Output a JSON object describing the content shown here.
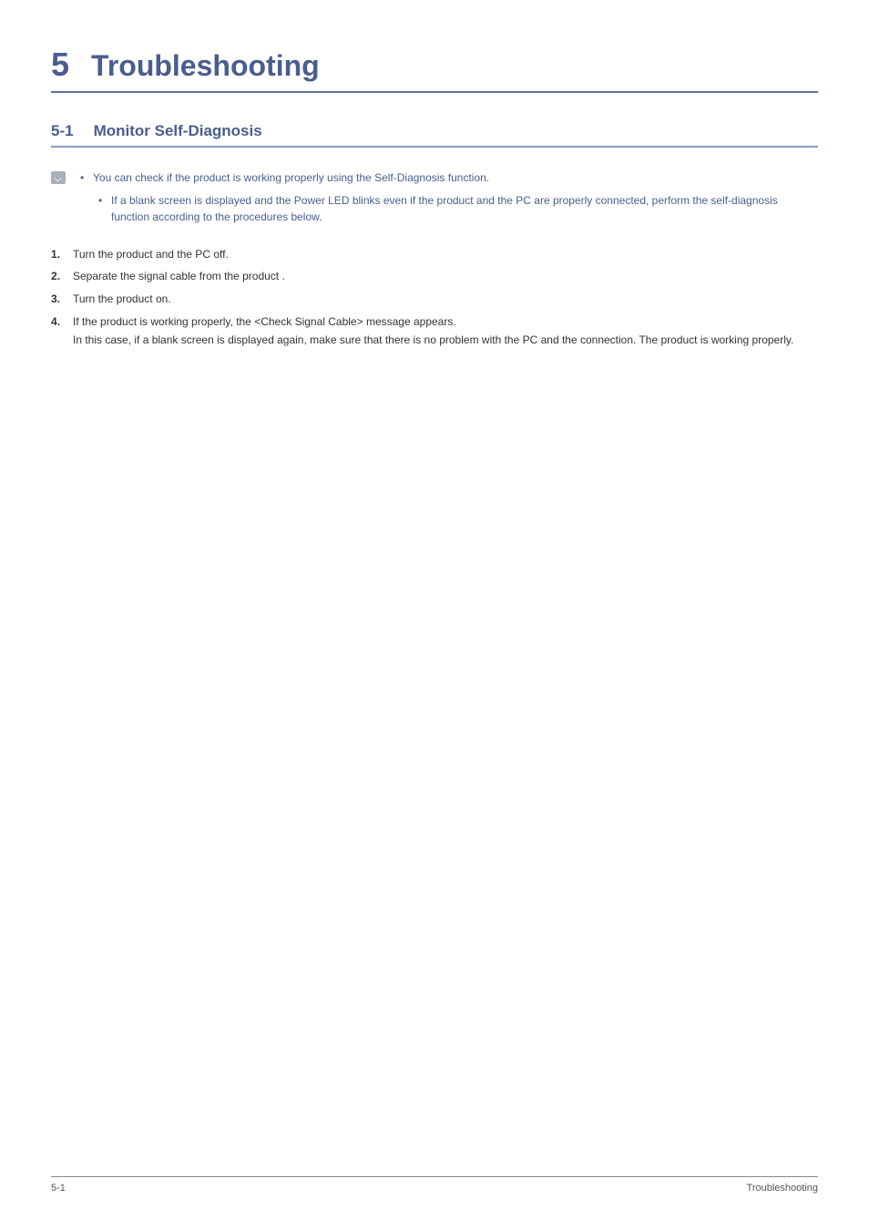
{
  "colors": {
    "chapter": "#4a5d8f",
    "section": "#4a5d8f",
    "note_text": "#4a5d8f"
  },
  "chapter": {
    "number": "5",
    "title": "Troubleshooting"
  },
  "section": {
    "number": "5-1",
    "title": "Monitor Self-Diagnosis"
  },
  "note": {
    "items": [
      {
        "text": "You can check if the product is working properly using the Self-Diagnosis function.",
        "subitems": [
          "If a blank screen is displayed and the Power LED blinks even if the product and the PC are properly connected, perform the self-diagnosis function according to the procedures below."
        ]
      }
    ]
  },
  "steps": [
    {
      "text": "Turn the product and the PC off."
    },
    {
      "text": "Separate the signal cable from the product ."
    },
    {
      "text": "Turn the product on."
    },
    {
      "text": "If the product is working properly, the <Check Signal Cable> message appears.",
      "extra": "In this case, if a blank screen is displayed again, make sure that there is no problem with the PC and the connection. The product is working properly."
    }
  ],
  "footer": {
    "left": "5-1",
    "right": "Troubleshooting"
  }
}
